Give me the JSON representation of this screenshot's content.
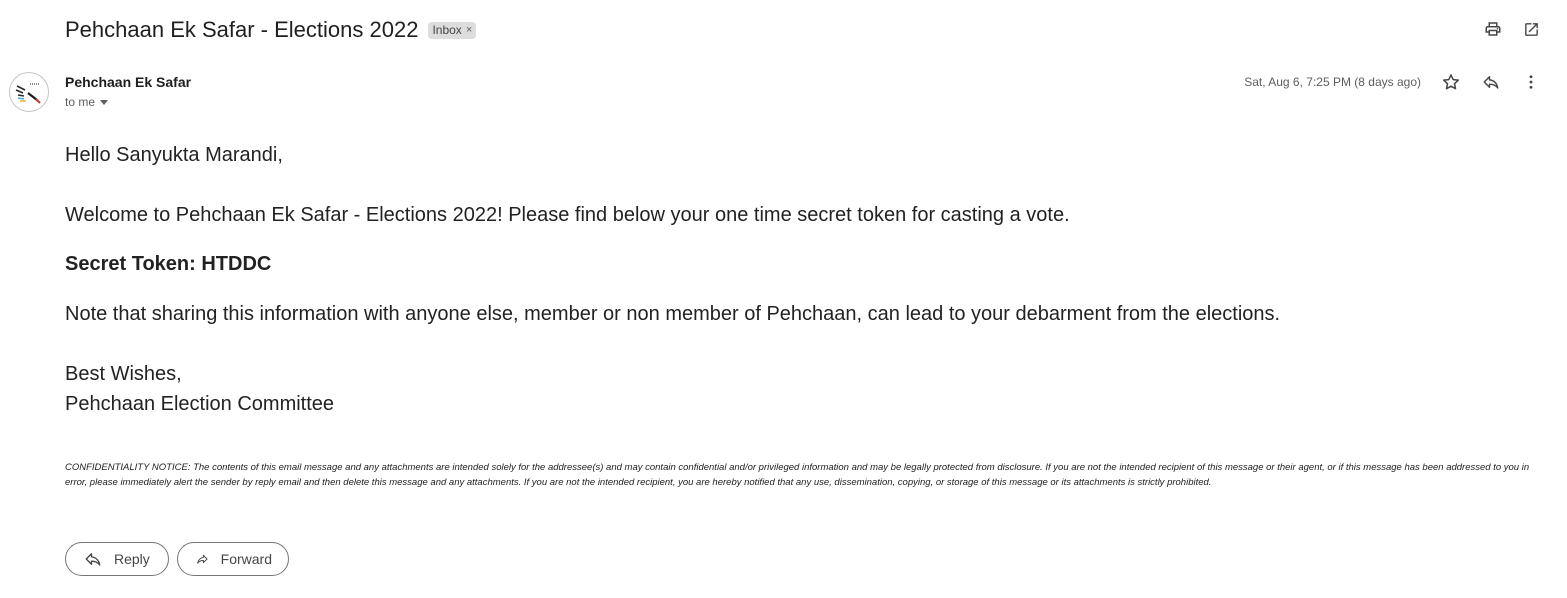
{
  "header": {
    "subject": "Pehchaan Ek Safar - Elections 2022",
    "label": "Inbox",
    "label_close": "×",
    "actions": [
      {
        "name": "print-icon",
        "label": "Print all"
      },
      {
        "name": "open-new-window-icon",
        "label": "In new window"
      }
    ]
  },
  "message": {
    "sender_name": "Pehchaan Ek Safar",
    "recipient": "to me",
    "date": "Sat, Aug 6, 7:25 PM (8 days ago)",
    "actions": [
      "star-icon",
      "reply-icon",
      "more-vert-icon"
    ]
  },
  "body": {
    "greeting": "Hello Sanyukta Marandi,",
    "intro": "Welcome to Pehchaan Ek Safar - Elections 2022! Please find below your one time secret token for casting a vote.",
    "token": "Secret Token: HTDDC",
    "note": "Note that sharing this information with anyone else, member or non member of Pehchaan, can lead to your debarment from the elections.",
    "signoff": "Best Wishes,",
    "signature": "Pehchaan Election Committee",
    "confidentiality": "CONFIDENTIALITY NOTICE: The contents of this email message and any attachments are intended solely for the addressee(s) and may contain confidential and/or privileged information and may be legally protected from disclosure. If you are not the intended recipient of this message or their agent, or if this message has been addressed to you in error, please immediately alert the sender by reply email and then delete this message and any attachments. If you are not the intended recipient, you are hereby notified that any use, dissemination, copying, or storage of this message or its attachments is strictly prohibited."
  },
  "footer": {
    "reply_label": "Reply",
    "forward_label": "Forward"
  }
}
